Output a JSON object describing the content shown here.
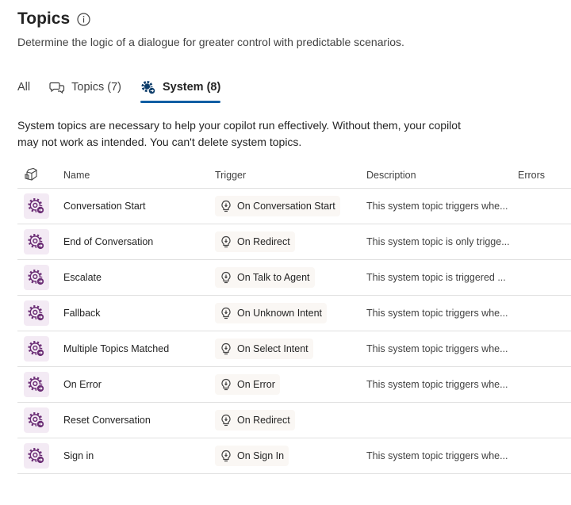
{
  "header": {
    "title": "Topics",
    "subtitle": "Determine the logic of a dialogue for greater control with predictable scenarios."
  },
  "tabs": [
    {
      "label": "All",
      "icon": "",
      "active": false
    },
    {
      "label": "Topics (7)",
      "icon": "chat-bubbles-icon",
      "active": false
    },
    {
      "label": "System (8)",
      "icon": "system-gear-icon",
      "active": true
    }
  ],
  "note": "System topics are necessary to help your copilot run effectively. Without them, your copilot may not work as intended. You can't delete system topics.",
  "table": {
    "columns": [
      "Name",
      "Trigger",
      "Description",
      "Errors"
    ],
    "rows": [
      {
        "name": "Conversation Start",
        "trigger": "On Conversation Start",
        "description": "This system topic triggers whe..."
      },
      {
        "name": "End of Conversation",
        "trigger": "On Redirect",
        "description": "This system topic is only trigge..."
      },
      {
        "name": "Escalate",
        "trigger": "On Talk to Agent",
        "description": "This system topic is triggered ..."
      },
      {
        "name": "Fallback",
        "trigger": "On Unknown Intent",
        "description": "This system topic triggers whe..."
      },
      {
        "name": "Multiple Topics Matched",
        "trigger": "On Select Intent",
        "description": "This system topic triggers whe..."
      },
      {
        "name": "On Error",
        "trigger": "On Error",
        "description": "This system topic triggers whe..."
      },
      {
        "name": "Reset Conversation",
        "trigger": "On Redirect",
        "description": ""
      },
      {
        "name": "Sign in",
        "trigger": "On Sign In",
        "description": "This system topic triggers whe..."
      }
    ]
  },
  "colors": {
    "accent": "#115ea3",
    "system_icon": "#6b2d75",
    "row_icon_bg": "#f3eaf4"
  }
}
